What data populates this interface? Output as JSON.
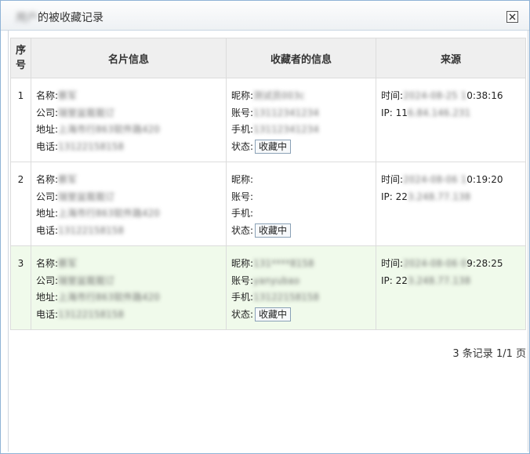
{
  "dialog": {
    "title_blur": "用户",
    "title": "的被收藏记录"
  },
  "table": {
    "headers": [
      "序号",
      "名片信息",
      "收藏者的信息",
      "来源"
    ],
    "card_labels": {
      "name": "名称:",
      "company": "公司:",
      "address": "地址:",
      "phone": "电话:"
    },
    "collector_labels": {
      "nickname": "昵称:",
      "account": "账号:",
      "mobile": "手机:",
      "status": "状态:"
    },
    "source_labels": {
      "time": "时间:",
      "ip": "IP:"
    },
    "rows": [
      {
        "index": "1",
        "card": {
          "name": "蔡军",
          "company": "瑞誉盆栽栽订",
          "address": "上海市行863软件路420",
          "phone": "13122158158"
        },
        "collector": {
          "nickname": "测试员003c",
          "account": "13112341234",
          "mobile": "13112341234",
          "status": "收藏中"
        },
        "source": {
          "time_blur": "2024-08-25 1",
          "time_clear": "0:38:16",
          "ip_clear": "11",
          "ip_blur": "6.84.146.231"
        }
      },
      {
        "index": "2",
        "card": {
          "name": "蔡军",
          "company": "瑞誉盆栽栽订",
          "address": "上海市行863软件路420",
          "phone": "13122158158"
        },
        "collector": {
          "nickname": "",
          "account": "",
          "mobile": "",
          "status": "收藏中"
        },
        "source": {
          "time_blur": "2024-08-06 1",
          "time_clear": "0:19:20",
          "ip_clear": "22",
          "ip_blur": "3.248.77.138"
        }
      },
      {
        "index": "3",
        "card": {
          "name": "蔡军",
          "company": "瑞誉盆栽栽订",
          "address": "上海市行863软件路420",
          "phone": "13122158158"
        },
        "collector": {
          "nickname": "131****8158",
          "account": "yanyubao",
          "mobile": "13122158158",
          "status": "收藏中"
        },
        "source": {
          "time_blur": "2024-08-06 0",
          "time_clear": "9:28:25",
          "ip_clear": "22",
          "ip_blur": "3.248.77.138"
        }
      }
    ]
  },
  "footer": {
    "summary": "3 条记录 1/1 页"
  }
}
